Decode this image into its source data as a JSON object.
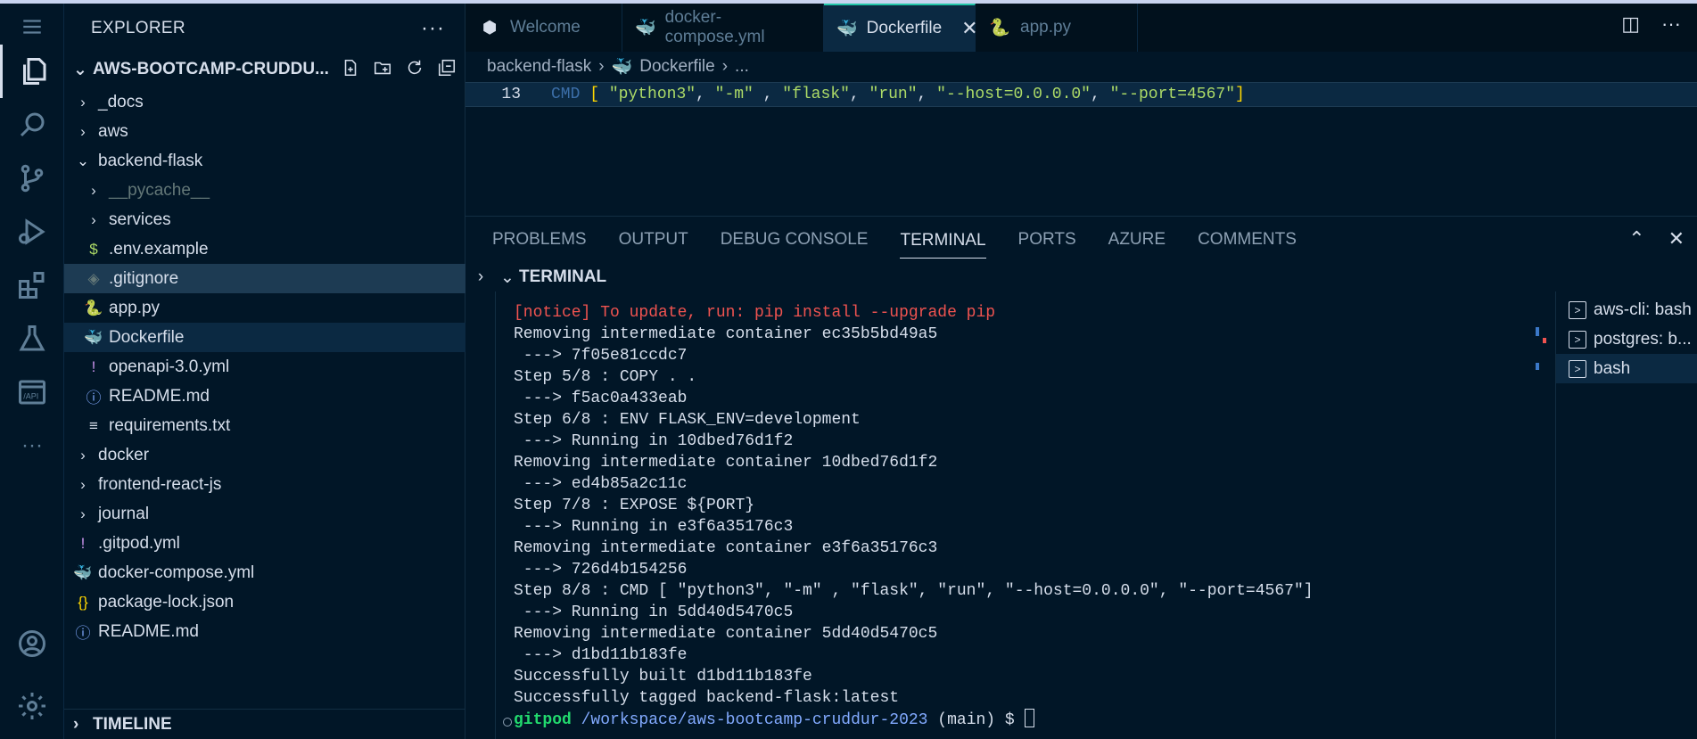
{
  "explorer": {
    "title": "EXPLORER",
    "root": "AWS-BOOTCAMP-CRUDDU...",
    "items": [
      {
        "label": "_docs",
        "kind": "folder",
        "indent": 1
      },
      {
        "label": "aws",
        "kind": "folder",
        "indent": 1
      },
      {
        "label": "backend-flask",
        "kind": "folder-open",
        "indent": 1
      },
      {
        "label": "__pycache__",
        "kind": "folder",
        "indent": 2
      },
      {
        "label": "services",
        "kind": "folder",
        "indent": 2
      },
      {
        "label": ".env.example",
        "kind": "env",
        "indent": 2
      },
      {
        "label": ".gitignore",
        "kind": "git",
        "indent": 2
      },
      {
        "label": "app.py",
        "kind": "python",
        "indent": 2
      },
      {
        "label": "Dockerfile",
        "kind": "docker",
        "indent": 2
      },
      {
        "label": "openapi-3.0.yml",
        "kind": "yml",
        "indent": 2
      },
      {
        "label": "README.md",
        "kind": "info",
        "indent": 2
      },
      {
        "label": "requirements.txt",
        "kind": "text",
        "indent": 2
      },
      {
        "label": "docker",
        "kind": "folder",
        "indent": 1
      },
      {
        "label": "frontend-react-js",
        "kind": "folder",
        "indent": 1
      },
      {
        "label": "journal",
        "kind": "folder",
        "indent": 1
      },
      {
        "label": ".gitpod.yml",
        "kind": "yml",
        "indent": 1
      },
      {
        "label": "docker-compose.yml",
        "kind": "docker-red",
        "indent": 1
      },
      {
        "label": "package-lock.json",
        "kind": "json",
        "indent": 1
      },
      {
        "label": "README.md",
        "kind": "info",
        "indent": 1
      }
    ],
    "timeline": "TIMELINE"
  },
  "tabs": [
    {
      "label": "Welcome",
      "icon": "gitpod-icon"
    },
    {
      "label": "docker-compose.yml",
      "icon": "docker-red-icon"
    },
    {
      "label": "Dockerfile",
      "icon": "docker-icon",
      "active": true
    },
    {
      "label": "app.py",
      "icon": "python-icon"
    }
  ],
  "breadcrumb": {
    "folder": "backend-flask",
    "file": "Dockerfile",
    "rest": "..."
  },
  "editor": {
    "line_number": "13",
    "keyword": "CMD",
    "args": [
      "\"python3\"",
      "\"-m\"",
      "\"flask\"",
      "\"run\"",
      "\"--host=0.0.0.0\"",
      "\"--port=4567\""
    ]
  },
  "panel": {
    "tabs": [
      "PROBLEMS",
      "OUTPUT",
      "DEBUG CONSOLE",
      "TERMINAL",
      "PORTS",
      "AZURE",
      "COMMENTS"
    ],
    "active_tab": "TERMINAL",
    "section_title": "TERMINAL"
  },
  "terminal": {
    "notice": "[notice] To update, run: pip install --upgrade pip",
    "lines": [
      "Removing intermediate container ec35b5bd49a5",
      " ---> 7f05e81ccdc7",
      "Step 5/8 : COPY . .",
      " ---> f5ac0a433eab",
      "Step 6/8 : ENV FLASK_ENV=development",
      " ---> Running in 10dbed76d1f2",
      "Removing intermediate container 10dbed76d1f2",
      " ---> ed4b85a2c11c",
      "Step 7/8 : EXPOSE ${PORT}",
      " ---> Running in e3f6a35176c3",
      "Removing intermediate container e3f6a35176c3",
      " ---> 726d4b154256",
      "Step 8/8 : CMD [ \"python3\", \"-m\" , \"flask\", \"run\", \"--host=0.0.0.0\", \"--port=4567\"]",
      " ---> Running in 5dd40d5470c5",
      "Removing intermediate container 5dd40d5470c5",
      " ---> d1bd11b183fe",
      "Successfully built d1bd11b183fe",
      "Successfully tagged backend-flask:latest"
    ],
    "prompt_user": "gitpod",
    "prompt_path": "/workspace/aws-bootcamp-cruddur-2023",
    "prompt_rest": " (main) $ "
  },
  "terminal_list": [
    {
      "label": "aws-cli: bash"
    },
    {
      "label": "postgres: b..."
    },
    {
      "label": "bash",
      "active": true
    }
  ],
  "colors": {
    "background": "#011627",
    "accent": "#21c7a8",
    "notice": "#ef5350",
    "prompt_user": "#22da6e",
    "prompt_path": "#82aaff"
  }
}
